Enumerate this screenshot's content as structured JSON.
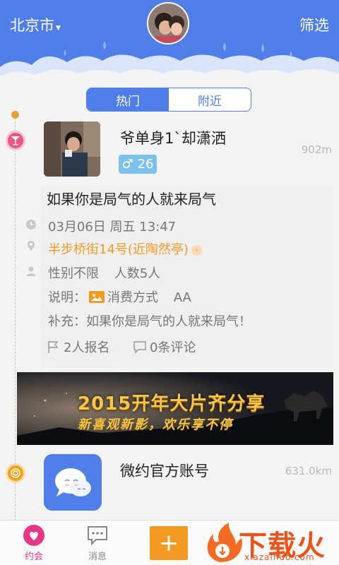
{
  "header": {
    "city": "北京市",
    "filter_label": "筛选"
  },
  "tabs": [
    {
      "label": "热门",
      "active": true
    },
    {
      "label": "附近",
      "active": false
    }
  ],
  "activity": {
    "username": "爷单身1`却潇洒",
    "gender_symbol": "♂",
    "age": "26",
    "distance": "902m",
    "title": "如果你是局气的人就来局气",
    "datetime": "03月06日 周五 13:47",
    "address": "半步桥街14号(近陶然亭)",
    "gender_limit": "性别不限",
    "headcount": "人数5人",
    "desc_label": "说明：",
    "payment": "消费方式",
    "payment_value": "AA",
    "supplement": "补充：如果你是局气的人就来局气！",
    "signups": "2人报名",
    "comments": "0条评论"
  },
  "banner": {
    "title": "2015开年大片齐分享",
    "subtitle": "新喜观新影，欢乐享不停"
  },
  "official": {
    "name": "微约官方账号",
    "distance": "631.0km"
  },
  "bottom_nav": {
    "dating": "约会",
    "messages": "消息",
    "add": "+"
  },
  "watermark": {
    "text": "下载火",
    "url": "xiazaihuo.com"
  },
  "colors": {
    "primary": "#4f7ee8",
    "accent": "#f39a22",
    "pink": "#e9578a"
  }
}
